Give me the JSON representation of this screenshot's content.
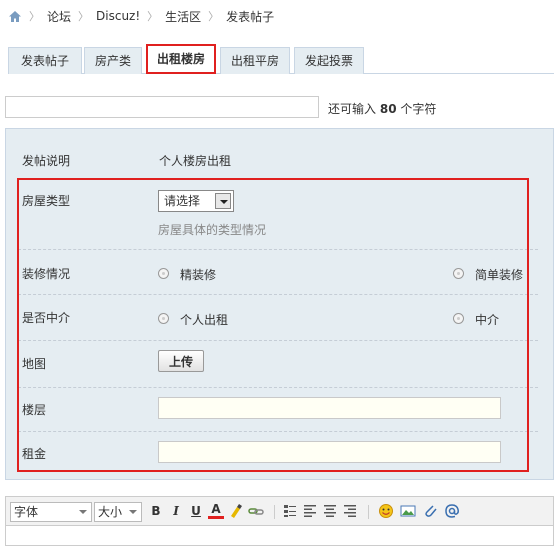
{
  "breadcrumb": {
    "items": [
      "论坛",
      "Discuz!",
      "生活区",
      "发表帖子"
    ]
  },
  "tabs": [
    {
      "label": "发表帖子",
      "active": false
    },
    {
      "label": "房产类",
      "active": false
    },
    {
      "label": "出租楼房",
      "active": true
    },
    {
      "label": "出租平房",
      "active": false
    },
    {
      "label": "发起投票",
      "active": false
    }
  ],
  "subject": {
    "value": "",
    "remaining_prefix": "还可输入",
    "remaining_count": "80",
    "remaining_suffix": "个字符"
  },
  "form": {
    "description_label": "发帖说明",
    "description_value": "个人楼房出租",
    "house_type_label": "房屋类型",
    "house_type_select": "请选择",
    "house_type_hint": "房屋具体的类型情况",
    "decoration_label": "装修情况",
    "decoration_options": [
      "精装修",
      "简单装修"
    ],
    "agency_label": "是否中介",
    "agency_options": [
      "个人出租",
      "中介"
    ],
    "map_label": "地图",
    "upload_label": "上传",
    "floor_label": "楼层",
    "floor_value": "",
    "rent_label": "租金",
    "rent_value": ""
  },
  "editor_toolbar": {
    "font_label": "字体",
    "size_label": "大小",
    "bold": "B",
    "italic": "I",
    "underline": "U",
    "font_color": "A"
  },
  "colors": {
    "accent_red": "#e0201f",
    "panel_bg": "#e5edf2",
    "tab_bg": "#e5edf2",
    "border": "#c9d6e4"
  }
}
